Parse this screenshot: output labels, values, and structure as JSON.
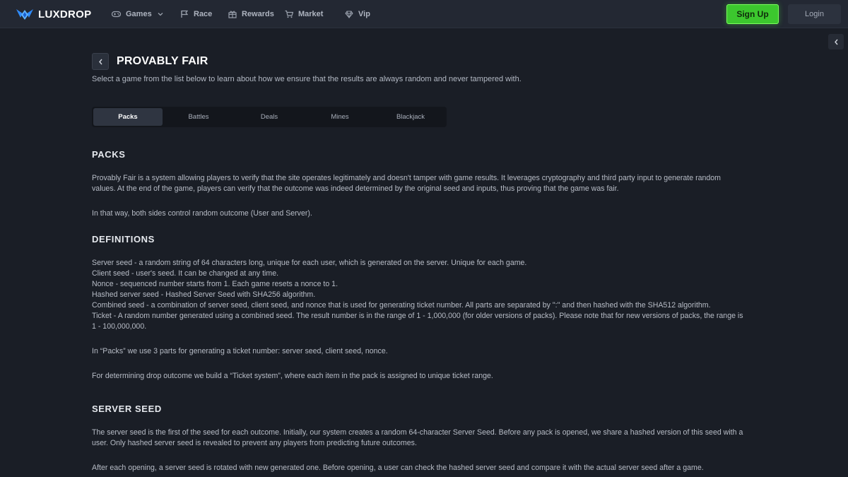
{
  "brand": {
    "name": "LUXDROP"
  },
  "nav": {
    "items": [
      {
        "label": "Games",
        "icon": "gamepad-icon"
      },
      {
        "label": "Race",
        "icon": "flag-icon"
      },
      {
        "label": "Rewards",
        "icon": "gift-icon"
      },
      {
        "label": "Market",
        "icon": "cart-icon"
      },
      {
        "label": "Vip",
        "icon": "diamond-icon"
      }
    ],
    "signup_label": "Sign Up",
    "login_label": "Login"
  },
  "header": {
    "title": "PROVABLY FAIR",
    "subtitle": "Select a game from the list below to learn about how we ensure that the results are always random and never tampered with."
  },
  "tabs": [
    {
      "label": "Packs",
      "active": true
    },
    {
      "label": "Battles",
      "active": false
    },
    {
      "label": "Deals",
      "active": false
    },
    {
      "label": "Mines",
      "active": false
    },
    {
      "label": "Blackjack",
      "active": false
    }
  ],
  "sections": {
    "packs": {
      "heading": "PACKS",
      "p1_line1": "Provably Fair is a system allowing players to verify that the site operates legitimately and doesn't tamper with game results. It leverages cryptography and third party input to generate random",
      "p1_line2": "values. At the end of the game, players can verify that the outcome was indeed determined by the original seed and inputs, thus proving that the game was fair.",
      "p2": "In that way, both sides control random outcome (User and Server)."
    },
    "definitions": {
      "heading": "DEFINITIONS",
      "lines": [
        "Server seed - a random string of 64 characters long, unique for each user, which is generated on the server. Unique for each game.",
        "Client seed - user's seed. It can be changed at any time.",
        "Nonce - sequenced number starts from 1. Each game resets a nonce to 1.",
        "Hashed server seed - Hashed Server Seed with SHA256 algorithm.",
        "Combined seed - a combination of server seed, client seed, and nonce that is used for generating ticket number. All parts are separated by \":\" and then hashed with the SHA512 algorithm.",
        "Ticket - A random number generated using a combined seed. The result number is in the range of 1 - 1,000,000 (for older versions of packs). Please note that for new versions of packs, the range is",
        "1 - 100,000,000."
      ],
      "p_parts": "In “Packs” we use 3 parts for generating a ticket number: server seed, client seed, nonce.",
      "p_ticket": "For determining drop outcome we build a “Ticket system”, where each item in the pack is assigned to unique ticket range."
    },
    "server_seed": {
      "heading": "SERVER SEED",
      "p1_line1": "The server seed is the first of the seed for each outcome. Initially, our system creates a random 64-character Server Seed. Before any pack is opened, we share a hashed version of this seed with a",
      "p1_line2": "user. Only hashed server seed is revealed to prevent any players from predicting future outcomes.",
      "p2": "After each opening, a server seed is rotated with new generated one. Before opening, a user can check the hashed server seed and compare it with the actual server seed after a game."
    }
  },
  "colors": {
    "background": "#1a1e26",
    "topbar": "#232833",
    "accent_green": "#3cc72e",
    "logo_blue": "#2f8cff"
  }
}
